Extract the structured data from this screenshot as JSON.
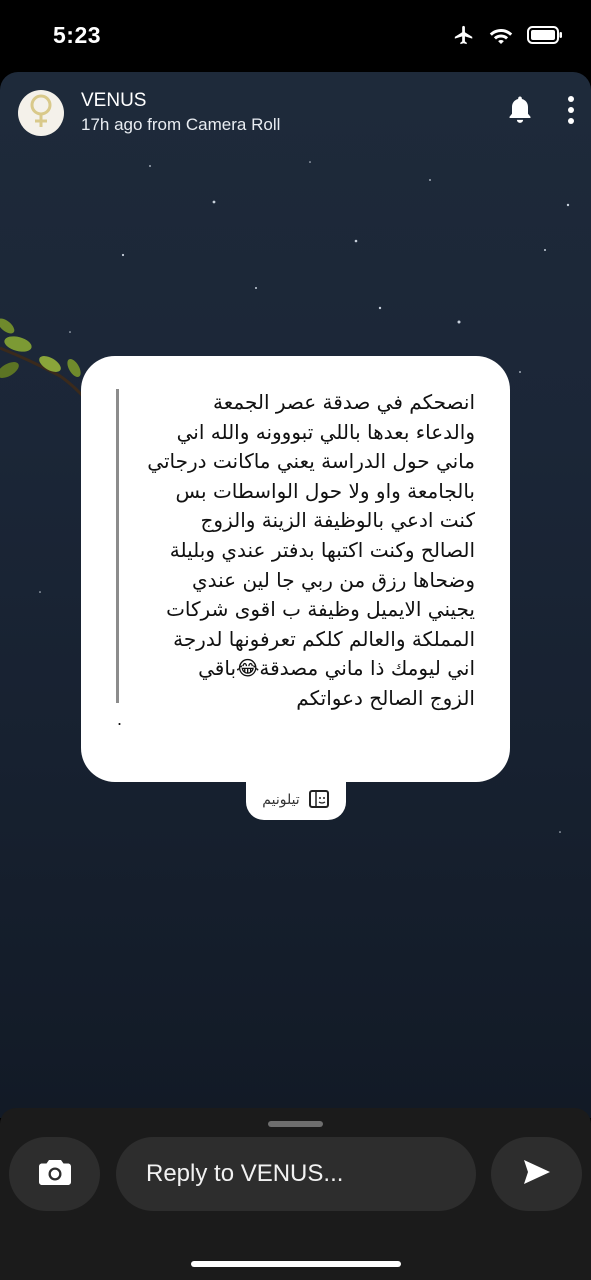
{
  "status_bar": {
    "time": "5:23",
    "icons": [
      "airplane-icon",
      "wifi-icon",
      "battery-icon"
    ]
  },
  "story": {
    "user_name": "VENUS",
    "meta": "17h ago from Camera Roll",
    "avatar_icon": "venus-symbol-icon",
    "actions": [
      "bell-icon",
      "more-vertical-icon"
    ]
  },
  "card": {
    "lines": [
      "انصحكم في صدقة عصر الجمعة",
      "والدعاء بعدها باللي تبووونه والله اني",
      "ماني حول الدراسة يعني ماكانت درجاتي",
      "بالجامعة واو ولا حول الواسطات بس",
      "كنت ادعي بالوظيفة الزينة والزوج",
      "الصالح وكنت اكتبها بدفتر عندي وبليلة",
      "وضحاها رزق من ربي جا لين عندي",
      "يجيني الايميل وظيفة ب اقوى شركات",
      "المملكة والعالم كلكم تعرفونها لدرجة",
      "اني ليومك ذا ماني مصدقة😂باقي",
      "الزوج الصالح دعواتكم"
    ],
    "trailing_mark": ".",
    "source_label": "تيلونيم"
  },
  "reply_bar": {
    "placeholder": "Reply to VENUS...",
    "camera_icon": "camera-icon",
    "send_icon": "send-icon"
  },
  "colors": {
    "background": "#000000",
    "story_bg": "#1b2637",
    "card_bg": "#ffffff",
    "bar_bg": "#1b1b1b",
    "button_bg": "#2d2d2d"
  }
}
